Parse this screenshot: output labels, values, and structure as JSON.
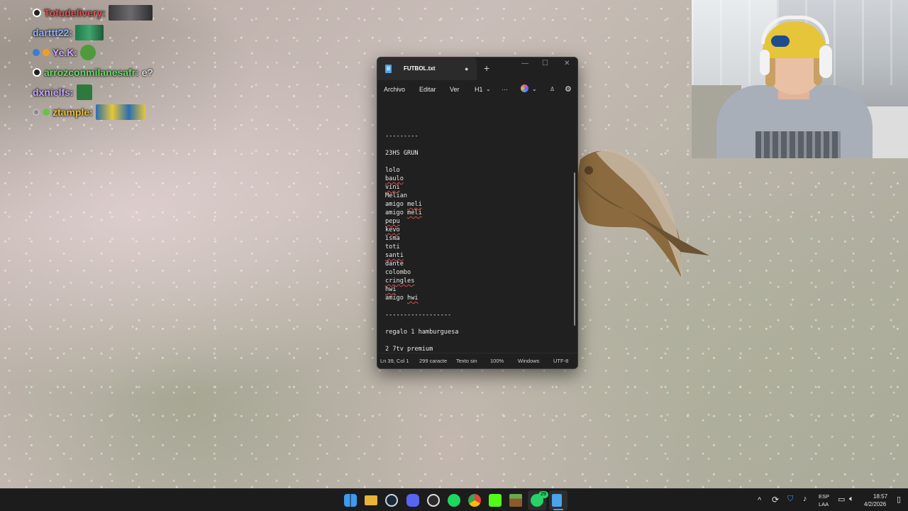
{
  "chat": {
    "messages": [
      {
        "user": "Tofudelivery",
        "colon": ":",
        "color": "#e05050",
        "text": ""
      },
      {
        "user": "darttt22",
        "colon": ":",
        "color": "#8fb3ff",
        "text": ""
      },
      {
        "user": "Ye.K",
        "colon": ":",
        "color": "#d4a4ff",
        "text": ""
      },
      {
        "user": "arrozconmilanesafr",
        "colon": ":",
        "color": "#63e063",
        "text": "e?"
      },
      {
        "user": "dxnielfs",
        "colon": ":",
        "color": "#c8a8ff",
        "text": ""
      },
      {
        "user": "ztample",
        "colon": ":",
        "color": "#e6c03a",
        "text": ""
      }
    ]
  },
  "notepad": {
    "tab_title": "FUTBOL.txt",
    "tab_modified": "●",
    "new_tab": "+",
    "window_controls": {
      "minimize": "—",
      "maximize": "☐",
      "close": "✕"
    },
    "menu": {
      "file": "Archivo",
      "edit": "Editar",
      "view": "Ver",
      "heading": "H1",
      "more": "···"
    },
    "lines": [
      {
        "text": "---------",
        "squiggle": false
      },
      {
        "text": "",
        "squiggle": false
      },
      {
        "text": "23HS GRUN",
        "squiggle": false
      },
      {
        "text": "",
        "squiggle": false
      },
      {
        "text": "lolo",
        "squiggle": false
      },
      {
        "text": "baulo",
        "squiggle": true
      },
      {
        "text": "vini",
        "squiggle": true
      },
      {
        "text": "Melian",
        "squiggle": false
      },
      {
        "text": "amigo meli",
        "squiggle": "meli"
      },
      {
        "text": "amigo meli",
        "squiggle": "meli"
      },
      {
        "text": "pepu",
        "squiggle": true
      },
      {
        "text": "kevo",
        "squiggle": true
      },
      {
        "text": "isma",
        "squiggle": false
      },
      {
        "text": "toti",
        "squiggle": false
      },
      {
        "text": "santi",
        "squiggle": true
      },
      {
        "text": "dante",
        "squiggle": false
      },
      {
        "text": "colombo",
        "squiggle": false
      },
      {
        "text": "cringles",
        "squiggle": true
      },
      {
        "text": "hwi",
        "squiggle": true
      },
      {
        "text": "amigo hwi",
        "squiggle": "hwi"
      },
      {
        "text": "",
        "squiggle": false
      },
      {
        "text": "------------------",
        "squiggle": false
      },
      {
        "text": "",
        "squiggle": false
      },
      {
        "text": "regalo 1 hamburguesa",
        "squiggle": false
      },
      {
        "text": "",
        "squiggle": false
      },
      {
        "text": "2 7tv premium",
        "squiggle": false
      }
    ],
    "status": {
      "position": "Ln 39, Col 1",
      "chars": "299 caracte",
      "format": "Texto sin",
      "zoom": "100%",
      "line_ending": "Windows",
      "encoding": "UTF-8"
    }
  },
  "taskbar": {
    "whatsapp_badge": "29",
    "language": "ESP",
    "layout": "LAA",
    "time": "18:57",
    "date": "4/2/2026",
    "tray_chevron": "^"
  },
  "colors": {
    "taskbar": "#1c1c1c",
    "notepad_bg": "#202020",
    "squiggle": "#e04848",
    "windows_blue": "#3d9bf0"
  }
}
